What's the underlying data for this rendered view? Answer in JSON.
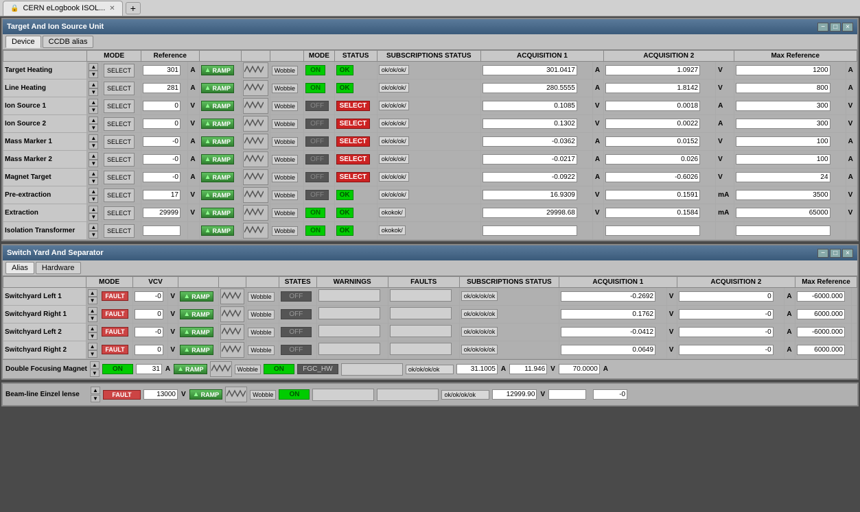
{
  "browser": {
    "tab_text": "CERN eLogbook ISOL...",
    "new_tab": "+"
  },
  "top_window": {
    "title": "Target And Ion Source Unit",
    "controls": [
      "−",
      "□",
      "×"
    ],
    "tabs": [
      "Device",
      "CCDB alias"
    ],
    "headers": {
      "col1": "",
      "mode": "MODE",
      "reference": "Reference",
      "ramp": "",
      "wobble": "",
      "mode2": "MODE",
      "status": "STATUS",
      "subs": "SUBSCRIPTIONS STATUS",
      "acq1": "ACQUISITION 1",
      "acq2": "ACQUISITION 2",
      "maxref": "Max Reference"
    },
    "rows": [
      {
        "label": "Target Heating",
        "mode_val": "SELECT",
        "ref_val": "301",
        "ref_unit": "A",
        "ramp": "RAMP",
        "mode_status": "ON",
        "status": "OK",
        "subs": "ok/ok/ok/",
        "acq1_val": "301.0417",
        "acq1_unit": "A",
        "acq2_val": "1.0927",
        "acq2_unit": "V",
        "maxref_val": "1200",
        "maxref_unit": "A"
      },
      {
        "label": "Line Heating",
        "mode_val": "SELECT",
        "ref_val": "281",
        "ref_unit": "A",
        "ramp": "RAMP",
        "mode_status": "ON",
        "status": "OK",
        "subs": "ok/ok/ok/",
        "acq1_val": "280.5555",
        "acq1_unit": "A",
        "acq2_val": "1.8142",
        "acq2_unit": "V",
        "maxref_val": "800",
        "maxref_unit": "A"
      },
      {
        "label": "Ion Source 1",
        "mode_val": "SELECT",
        "ref_val": "0",
        "ref_unit": "V",
        "ramp": "RAMP",
        "mode_status": "OFF",
        "status": "SELECT",
        "subs": "ok/ok/ok/",
        "acq1_val": "0.1085",
        "acq1_unit": "V",
        "acq2_val": "0.0018",
        "acq2_unit": "A",
        "maxref_val": "300",
        "maxref_unit": "V"
      },
      {
        "label": "Ion Source 2",
        "mode_val": "SELECT",
        "ref_val": "0",
        "ref_unit": "V",
        "ramp": "RAMP",
        "mode_status": "OFF",
        "status": "SELECT",
        "subs": "ok/ok/ok/",
        "acq1_val": "0.1302",
        "acq1_unit": "V",
        "acq2_val": "0.0022",
        "acq2_unit": "A",
        "maxref_val": "300",
        "maxref_unit": "V"
      },
      {
        "label": "Mass Marker 1",
        "mode_val": "SELECT",
        "ref_val": "-0",
        "ref_unit": "A",
        "ramp": "RAMP",
        "mode_status": "OFF",
        "status": "SELECT",
        "subs": "ok/ok/ok/",
        "acq1_val": "-0.0362",
        "acq1_unit": "A",
        "acq2_val": "0.0152",
        "acq2_unit": "V",
        "maxref_val": "100",
        "maxref_unit": "A"
      },
      {
        "label": "Mass Marker 2",
        "mode_val": "SELECT",
        "ref_val": "-0",
        "ref_unit": "A",
        "ramp": "RAMP",
        "mode_status": "OFF",
        "status": "SELECT",
        "subs": "ok/ok/ok/",
        "acq1_val": "-0.0217",
        "acq1_unit": "A",
        "acq2_val": "0.026",
        "acq2_unit": "V",
        "maxref_val": "100",
        "maxref_unit": "A"
      },
      {
        "label": "Magnet Target",
        "mode_val": "SELECT",
        "ref_val": "-0",
        "ref_unit": "A",
        "ramp": "RAMP",
        "mode_status": "OFF",
        "status": "SELECT",
        "subs": "ok/ok/ok/",
        "acq1_val": "-0.0922",
        "acq1_unit": "A",
        "acq2_val": "-0.6026",
        "acq2_unit": "V",
        "maxref_val": "24",
        "maxref_unit": "A"
      },
      {
        "label": "Pre-extraction",
        "mode_val": "SELECT",
        "ref_val": "17",
        "ref_unit": "V",
        "ramp": "RAMP",
        "mode_status": "OFF",
        "status": "OK",
        "subs": "ok/ok/ok/",
        "acq1_val": "16.9309",
        "acq1_unit": "V",
        "acq2_val": "0.1591",
        "acq2_unit": "mA",
        "maxref_val": "3500",
        "maxref_unit": "V"
      },
      {
        "label": "Extraction",
        "mode_val": "SELECT",
        "ref_val": "29999",
        "ref_unit": "V",
        "ramp": "RAMP",
        "mode_status": "ON",
        "status": "OK",
        "subs": "okokok/",
        "acq1_val": "29998.68",
        "acq1_unit": "V",
        "acq2_val": "0.1584",
        "acq2_unit": "mA",
        "maxref_val": "65000",
        "maxref_unit": "V"
      },
      {
        "label": "Isolation Transformer",
        "mode_val": "SELECT",
        "ref_val": "",
        "ref_unit": "",
        "ramp": "RAMP",
        "mode_status": "ON",
        "status": "OK",
        "subs": "okokok/",
        "acq1_val": "",
        "acq1_unit": "",
        "acq2_val": "",
        "acq2_unit": "",
        "maxref_val": "",
        "maxref_unit": ""
      }
    ]
  },
  "switch_window": {
    "title": "Switch Yard And Separator",
    "tabs": [
      "Alias",
      "Hardware"
    ],
    "headers": {
      "mode": "MODE",
      "vcv": "VCV",
      "states": "STATES",
      "warnings": "WARNINGS",
      "faults": "FAULTS",
      "subs": "SUBSCRIPTIONS STATUS",
      "acq1": "ACQUISITION 1",
      "acq2": "ACQUISITION 2",
      "maxref": "Max Reference"
    },
    "rows": [
      {
        "label": "Switchyard Left 1",
        "mode_val": "FAULT",
        "vcv_val": "-0",
        "vcv_unit": "V",
        "ramp": "RAMP",
        "states": "OFF",
        "warnings": "",
        "faults": "",
        "subs": "ok/ok/ok/ok",
        "acq1_val": "-0.2692",
        "acq1_unit": "V",
        "acq2_val": "0",
        "acq2_unit": "A",
        "maxref_val": "-6000.000",
        "maxref_unit": ""
      },
      {
        "label": "Switchyard Right 1",
        "mode_val": "FAULT",
        "vcv_val": "0",
        "vcv_unit": "V",
        "ramp": "RAMP",
        "states": "OFF",
        "warnings": "",
        "faults": "",
        "subs": "ok/ok/ok/ok",
        "acq1_val": "0.1762",
        "acq1_unit": "V",
        "acq2_val": "-0",
        "acq2_unit": "A",
        "maxref_val": "6000.000",
        "maxref_unit": ""
      },
      {
        "label": "Switchyard Left 2",
        "mode_val": "FAULT",
        "vcv_val": "-0",
        "vcv_unit": "V",
        "ramp": "RAMP",
        "states": "OFF",
        "warnings": "",
        "faults": "",
        "subs": "ok/ok/ok/ok",
        "acq1_val": "-0.0412",
        "acq1_unit": "V",
        "acq2_val": "-0",
        "acq2_unit": "A",
        "maxref_val": "-6000.000",
        "maxref_unit": ""
      },
      {
        "label": "Switchyard Right 2",
        "mode_val": "FAULT",
        "vcv_val": "0",
        "vcv_unit": "V",
        "ramp": "RAMP",
        "states": "OFF",
        "warnings": "",
        "faults": "",
        "subs": "ok/ok/ok/ok",
        "acq1_val": "0.0649",
        "acq1_unit": "V",
        "acq2_val": "-0",
        "acq2_unit": "A",
        "maxref_val": "6000.000",
        "maxref_unit": ""
      }
    ],
    "dfm": {
      "label": "Double Focusing Magnet",
      "mode_val": "ON",
      "ref_val": "31",
      "ref_unit": "A",
      "ramp": "RAMP",
      "states": "ON",
      "warnings": "FGC_HW",
      "faults": "",
      "subs": "ok/ok/ok/ok",
      "acq1_val": "31.1005",
      "acq1_unit": "A",
      "acq2_val": "11.946",
      "acq2_unit": "V",
      "maxref_val": "70.0000",
      "maxref_unit": "A"
    }
  },
  "bottom_strip": {
    "label": "Beam-line Einzel lense",
    "mode_val": "FAULT",
    "ref_val": "13000",
    "ref_unit": "V",
    "ramp": "RAMP",
    "states": "ON",
    "warnings": "",
    "faults": "",
    "subs": "ok/ok/ok/ok",
    "acq1_val": "12999.90",
    "acq1_unit": "V",
    "acq2_val": "",
    "acq2_unit": "",
    "maxref_val": "-0",
    "maxref_unit": ""
  }
}
